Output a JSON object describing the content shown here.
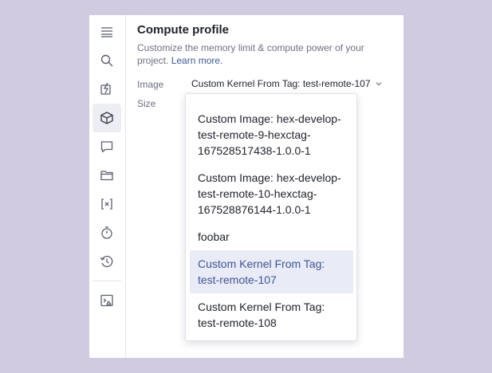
{
  "panel": {
    "title": "Compute profile",
    "description": "Customize the memory limit & compute power of your project.",
    "learn_more": "Learn more.",
    "image_label": "Image",
    "size_label": "Size",
    "image_value": "Custom Kernel From Tag: test-remote-107"
  },
  "sidebar": {
    "items": [
      {
        "icon": "menu-icon"
      },
      {
        "icon": "search-icon"
      },
      {
        "icon": "lightning-icon"
      },
      {
        "icon": "cube-icon",
        "active": true
      },
      {
        "icon": "comment-icon"
      },
      {
        "icon": "folder-icon"
      },
      {
        "icon": "variable-icon"
      },
      {
        "icon": "timer-icon"
      },
      {
        "icon": "history-icon"
      },
      {
        "icon": "terminal-icon"
      }
    ]
  },
  "dropdown": {
    "options": [
      {
        "label": "Custom Image: hex-develop-test-remote-9-hexctag-167528517438-1.0.0-1"
      },
      {
        "label": "Custom Image: hex-develop-test-remote-10-hexctag-167528876144-1.0.0-1"
      },
      {
        "label": "foobar"
      },
      {
        "label": "Custom Kernel From Tag: test-remote-107",
        "selected": true
      },
      {
        "label": "Custom Kernel From Tag: test-remote-108"
      }
    ]
  },
  "colors": {
    "background": "#d0cbe0",
    "accent": "#3e5596",
    "selected_bg": "#e9ecf7"
  }
}
